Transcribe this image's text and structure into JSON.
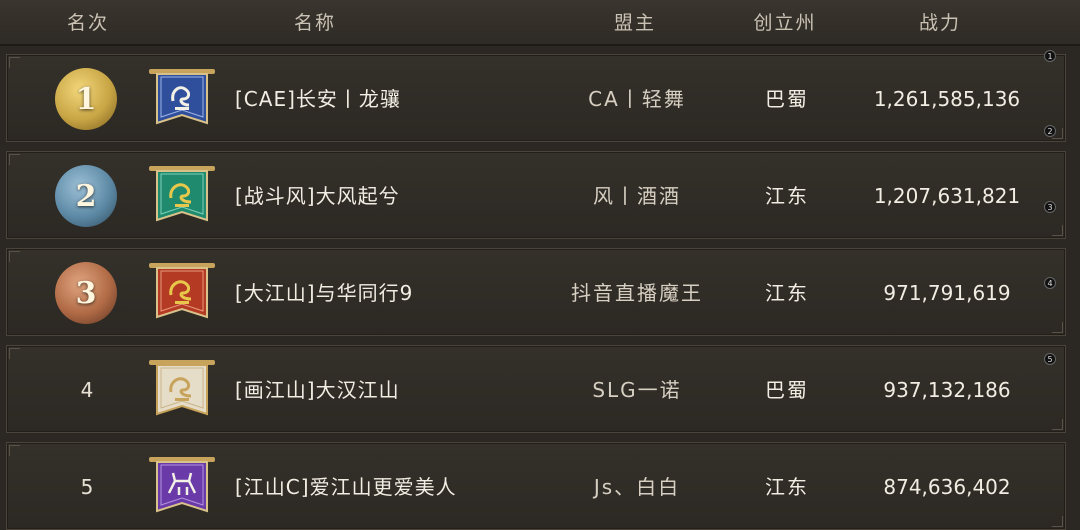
{
  "header": {
    "rank": "名次",
    "name": "名称",
    "leader": "盟主",
    "state": "创立州",
    "power": "战力"
  },
  "rows": [
    {
      "rank": "1",
      "name": "[CAE]长安丨龙骧",
      "leader": "CA丨轻舞",
      "state": "巴蜀",
      "power": "1,261,585,136",
      "medal_color": "#c8a545",
      "banner_color": "#2f4e9c",
      "banner_icon": "dragon-icon"
    },
    {
      "rank": "2",
      "name": "[战斗风]大风起兮",
      "leader": "风丨酒酒",
      "state": "江东",
      "power": "1,207,631,821",
      "medal_color": "#5e8aa6",
      "banner_color": "#1f8a6e",
      "banner_icon": "dragon-icon"
    },
    {
      "rank": "3",
      "name": "[大江山]与华同行9",
      "leader": "抖音直播魔王",
      "state": "江东",
      "power": "971,791,619",
      "medal_color": "#b06a45",
      "banner_color": "#b43a24",
      "banner_icon": "dragon-icon"
    },
    {
      "rank": "4",
      "name": "[画江山]大汉江山",
      "leader": "SLG一诺",
      "state": "巴蜀",
      "power": "937,132,186",
      "medal_color": "",
      "banner_color": "#e6ddc9",
      "banner_icon": "dragon-icon"
    },
    {
      "rank": "5",
      "name": "[江山C]爱江山更爱美人",
      "leader": "Js、白白",
      "state": "江东",
      "power": "874,636,402",
      "medal_color": "",
      "banner_color": "#6a3aa8",
      "banner_icon": "deer-icon"
    }
  ],
  "side_badges": [
    "1",
    "2",
    "3",
    "4",
    "5"
  ]
}
